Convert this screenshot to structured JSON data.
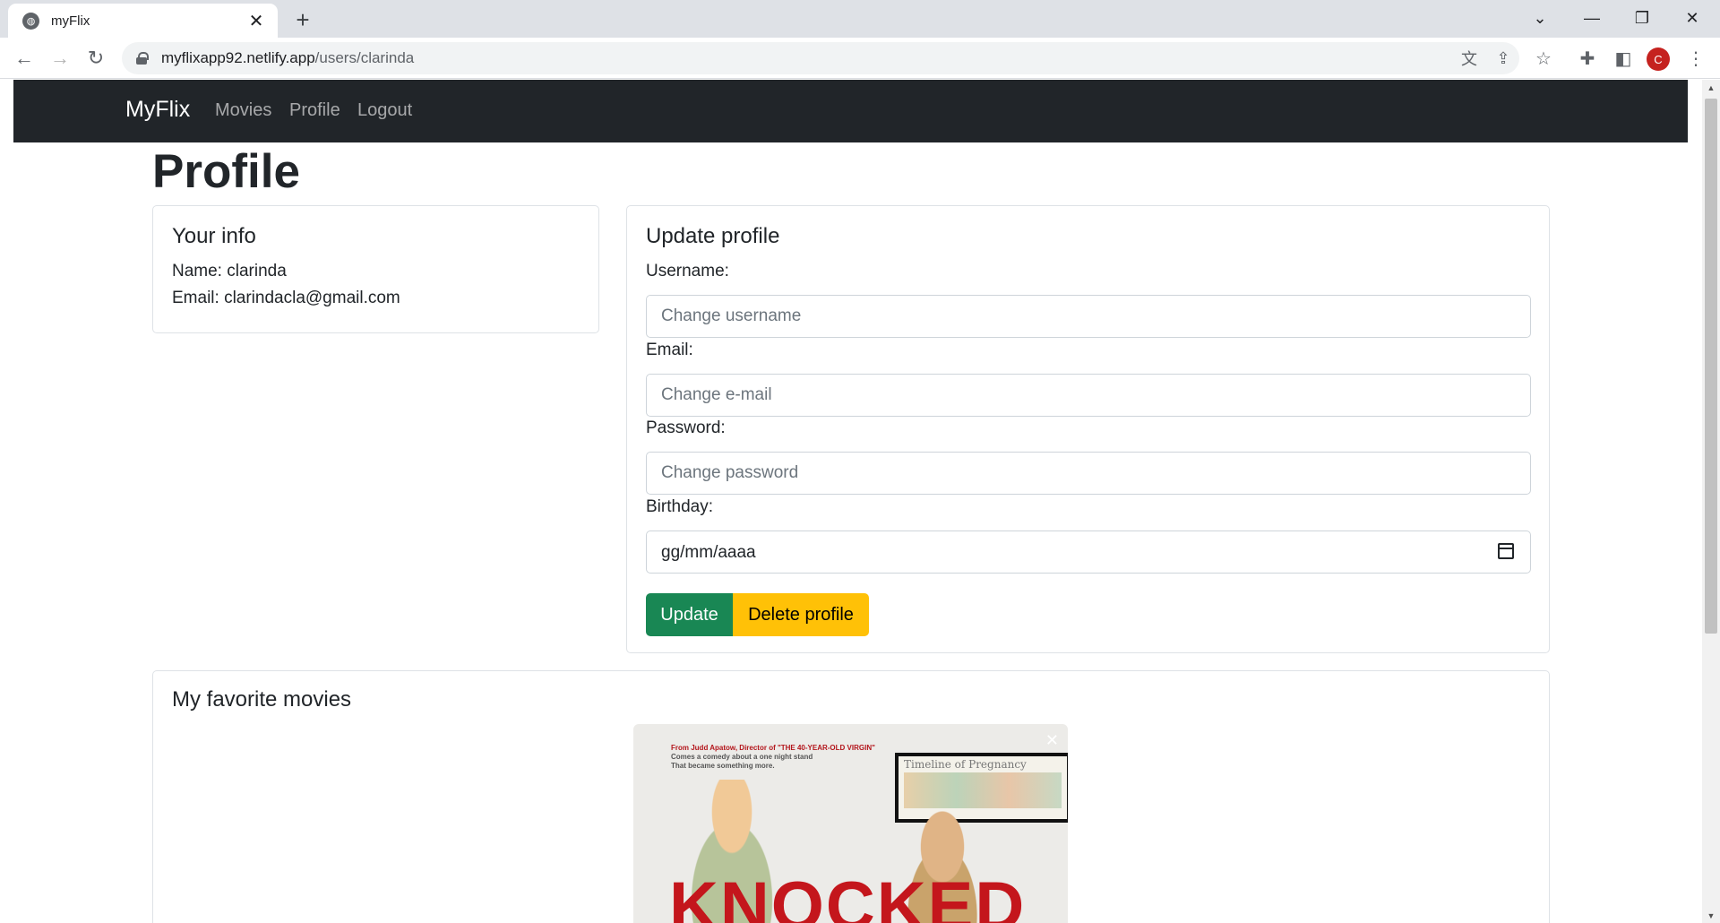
{
  "browser": {
    "tab_title": "myFlix",
    "url_host": "myflixapp92.netlify.app",
    "url_path": "/users/clarinda",
    "profile_initial": "C"
  },
  "navbar": {
    "brand": "MyFlix",
    "links": [
      "Movies",
      "Profile",
      "Logout"
    ]
  },
  "page": {
    "title": "Profile"
  },
  "info_card": {
    "title": "Your info",
    "name_line": "Name: clarinda",
    "email_line": "Email: clarindacla@gmail.com"
  },
  "update_form": {
    "title": "Update profile",
    "username_label": "Username:",
    "username_placeholder": "Change username",
    "email_label": "Email:",
    "email_placeholder": "Change e-mail",
    "password_label": "Password:",
    "password_placeholder": "Change password",
    "birthday_label": "Birthday:",
    "birthday_value": "gg/mm/aaaa",
    "update_button": "Update",
    "delete_button": "Delete profile"
  },
  "favorites": {
    "title": "My favorite movies",
    "movies": [
      {
        "poster_tagline_1": "From Judd Apatow, Director of \"THE 40-YEAR-OLD VIRGIN\"",
        "poster_tagline_2": "Comes a comedy about a one night stand",
        "poster_tagline_3": "That became something more.",
        "poster_board_title": "Timeline of Pregnancy",
        "poster_title": "KNOCKED",
        "remove_symbol": "✕"
      }
    ]
  },
  "colors": {
    "navbar_bg": "#212529",
    "update_button": "#198754",
    "delete_button": "#ffc107"
  }
}
